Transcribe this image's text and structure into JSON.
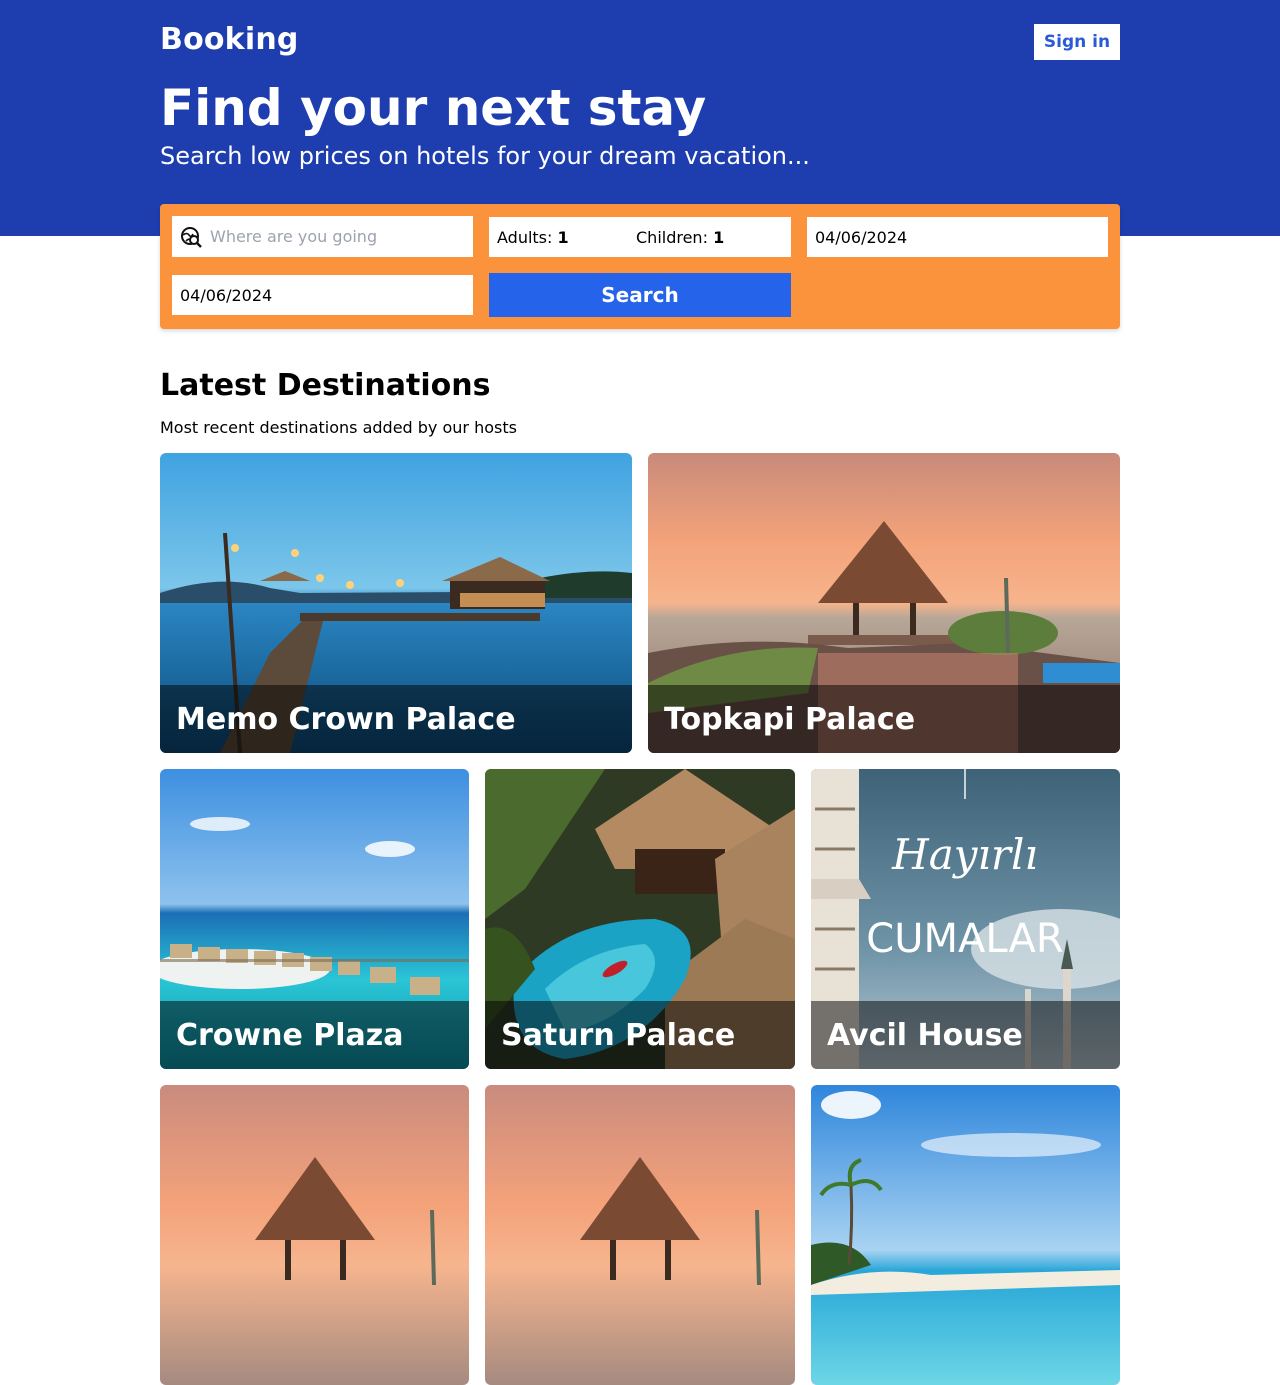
{
  "header": {
    "logo": "Booking",
    "sign_in_label": "Sign in"
  },
  "hero": {
    "title": "Find your next stay",
    "subtitle": "Search low prices on hotels for your dream vacation..."
  },
  "search": {
    "destination_placeholder": "Where are you going",
    "adults_label": "Adults:",
    "adults_value": "1",
    "children_label": "Children:",
    "children_value": "1",
    "check_in": "04/06/2024",
    "check_out": "04/06/2024",
    "button_label": "Search"
  },
  "destinations": {
    "title": "Latest Destinations",
    "subtitle": "Most recent destinations added by our hosts",
    "items": [
      {
        "name": "Memo Crown Palace"
      },
      {
        "name": "Topkapi Palace"
      },
      {
        "name": "Crowne Plaza"
      },
      {
        "name": "Saturn Palace"
      },
      {
        "name": "Avcil House",
        "image_text_1": "Hayırlı",
        "image_text_2": "CUMALAR"
      },
      {
        "name": ""
      },
      {
        "name": ""
      },
      {
        "name": ""
      }
    ]
  },
  "colors": {
    "brand_blue": "#1e3eb0",
    "search_orange": "#fb923c",
    "button_blue": "#2563eb"
  }
}
